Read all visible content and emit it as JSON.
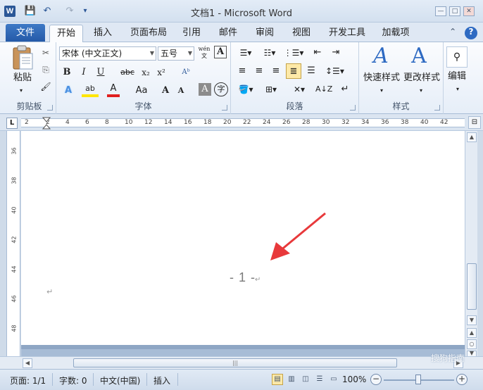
{
  "window": {
    "title": "文档1 - Microsoft Word",
    "app_icon": "W",
    "controls": {
      "minimize": "—",
      "maximize": "□",
      "close": "✕"
    }
  },
  "qat": {
    "save": "💾",
    "undo": "↶",
    "redo": "↷",
    "customize": "▾"
  },
  "tabs": {
    "file": "文件",
    "items": [
      "开始",
      "插入",
      "页面布局",
      "引用",
      "邮件",
      "审阅",
      "视图",
      "开发工具",
      "加载项"
    ],
    "active_index": 0
  },
  "ribbon": {
    "clipboard": {
      "paste": "粘贴",
      "label": "剪贴板",
      "cut": "✂",
      "copy": "⎘",
      "format_painter": "🖌"
    },
    "font": {
      "label": "字体",
      "font_name": "宋体 (中文正文)",
      "font_size": "五号",
      "phonetic": "wén",
      "border_char": "A",
      "bold": "B",
      "italic": "I",
      "underline": "U",
      "strike": "abc",
      "subscript": "x₂",
      "superscript": "x²",
      "text_effects": "A",
      "highlight": "ab",
      "font_color": "A",
      "change_case": "Aa",
      "grow": "A",
      "shrink": "A",
      "char_shading": "A",
      "enclose": "字"
    },
    "paragraph": {
      "label": "段落"
    },
    "styles": {
      "label": "样式",
      "quick_styles": "快速样式",
      "change_styles": "更改样式"
    },
    "editing": {
      "label": "编辑"
    }
  },
  "ruler": {
    "corner": "L",
    "labels": [
      "2",
      "2",
      "4",
      "6",
      "8",
      "10",
      "12",
      "14",
      "16",
      "18",
      "20",
      "22",
      "24",
      "26",
      "28",
      "30",
      "32",
      "34",
      "36",
      "38",
      "40",
      "42"
    ]
  },
  "vruler": {
    "labels": [
      "36",
      "38",
      "40",
      "42",
      "44",
      "46",
      "48"
    ]
  },
  "document": {
    "page_number_text": "- 1 -",
    "paragraph_mark": "↵"
  },
  "statusbar": {
    "page": "页面: 1/1",
    "words": "字数: 0",
    "language": "中文(中国)",
    "mode": "插入",
    "zoom": "100%",
    "zoom_level_percent": 100
  },
  "watermark": "搜狗指南",
  "colors": {
    "accent": "#2b5797",
    "arrow": "#e8393b"
  }
}
